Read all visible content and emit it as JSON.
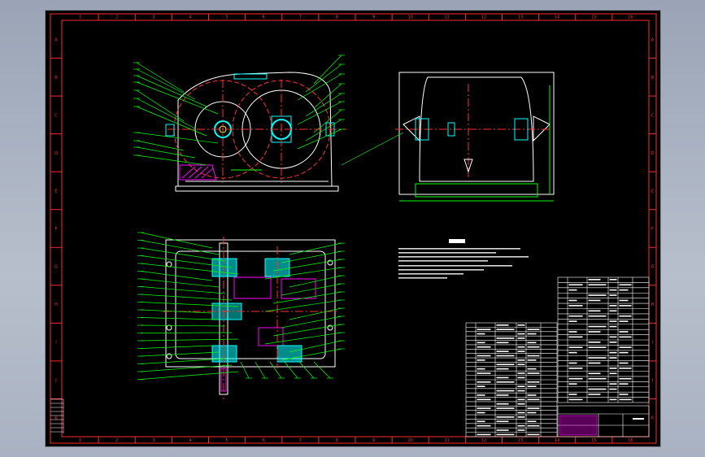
{
  "drawing": {
    "column_labels": [
      "1",
      "2",
      "3",
      "4",
      "5",
      "6",
      "7",
      "8",
      "9",
      "10",
      "11",
      "12",
      "13",
      "14",
      "15",
      "16"
    ],
    "row_labels": [
      "A",
      "B",
      "C",
      "D",
      "E",
      "F",
      "G",
      "H",
      "I",
      "J",
      "K"
    ],
    "colors": {
      "frame": "#ff2a2a",
      "outline": "#ffffff",
      "leader": "#00ff00",
      "section": "#00ffff",
      "centerline": "#ff3030",
      "hatch": "#ff00ff",
      "text": "#ffffff"
    },
    "views": [
      "front-view",
      "side-view",
      "top-view"
    ],
    "notes_title": "技术要求",
    "bom_title": "明细表"
  }
}
